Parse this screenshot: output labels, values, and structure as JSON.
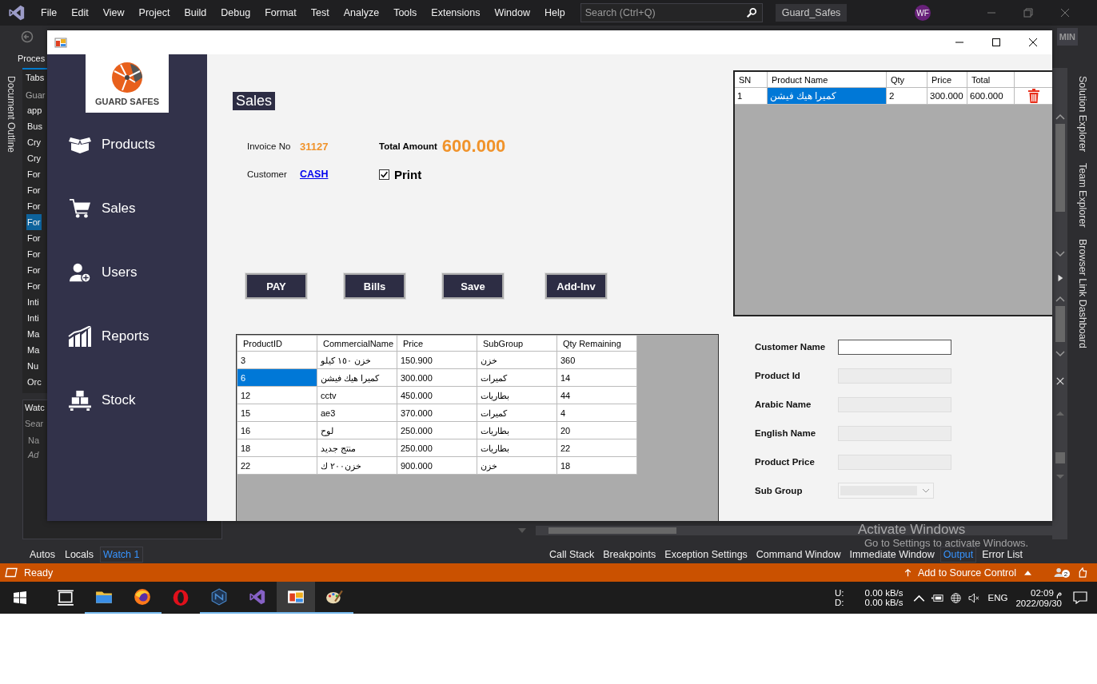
{
  "ide": {
    "menu": [
      "File",
      "Edit",
      "View",
      "Project",
      "Build",
      "Debug",
      "Format",
      "Test",
      "Analyze",
      "Tools",
      "Extensions",
      "Window",
      "Help"
    ],
    "search": {
      "placeholder": "Search (Ctrl+Q)"
    },
    "solution_name": "Guard_Safes",
    "user_initials": "WF",
    "toolbar_badge": "MIN",
    "process_label": "Proces",
    "left_strip": "Document Outline",
    "tabs_panel": {
      "title": "Tabs",
      "header": "Guar",
      "items": [
        {
          "text": "app",
          "selected": false
        },
        {
          "text": "Bus",
          "selected": false
        },
        {
          "text": "Cry",
          "selected": false
        },
        {
          "text": "Cry",
          "selected": false
        },
        {
          "text": "For",
          "selected": false
        },
        {
          "text": "For",
          "selected": false
        },
        {
          "text": "For",
          "selected": false
        },
        {
          "text": "For",
          "selected": true
        },
        {
          "text": "For",
          "selected": false
        },
        {
          "text": "For",
          "selected": false
        },
        {
          "text": "For",
          "selected": false
        },
        {
          "text": "For",
          "selected": false
        },
        {
          "text": "Inti",
          "selected": false
        },
        {
          "text": "Inti",
          "selected": false
        },
        {
          "text": "Ma",
          "selected": false
        },
        {
          "text": "Ma",
          "selected": false
        },
        {
          "text": "Nu",
          "selected": false
        },
        {
          "text": "Orc",
          "selected": false
        }
      ]
    },
    "watch_panel": {
      "title": "Watc",
      "search": "Sear",
      "column": "Na",
      "row": "Ad"
    },
    "bottom_left_tabs": [
      {
        "label": "Autos",
        "selected": false
      },
      {
        "label": "Locals",
        "selected": false
      },
      {
        "label": "Watch 1",
        "selected": true
      }
    ],
    "bottom_right_tabs": [
      {
        "label": "Call Stack",
        "selected": false
      },
      {
        "label": "Breakpoints",
        "selected": false
      },
      {
        "label": "Exception Settings",
        "selected": false
      },
      {
        "label": "Command Window",
        "selected": false
      },
      {
        "label": "Immediate Window",
        "selected": false
      },
      {
        "label": "Output",
        "selected": true
      },
      {
        "label": "Error List",
        "selected": false
      }
    ],
    "right_tabs": [
      "Solution Explorer",
      "Team Explorer",
      "Browser Link Dashboard"
    ],
    "status_bar": {
      "text": "Ready",
      "source_control": "Add to Source Control",
      "notifications": "2"
    }
  },
  "activation_notice": {
    "title": "Activate Windows",
    "text": "Go to Settings to activate Windows."
  },
  "app": {
    "logo": "GUARD SAFES",
    "nav": [
      {
        "kind": "products",
        "label": "Products"
      },
      {
        "kind": "sales",
        "label": "Sales"
      },
      {
        "kind": "users",
        "label": "Users"
      },
      {
        "kind": "reports",
        "label": "Reports"
      },
      {
        "kind": "stock",
        "label": "Stock"
      }
    ],
    "title": "Sales",
    "invoice": {
      "label": "Invoice No",
      "value": "31127"
    },
    "total": {
      "label": "Total Amount",
      "value": "600.000"
    },
    "customer": {
      "label": "Customer",
      "value": "CASH"
    },
    "print": {
      "label": "Print",
      "checked": true
    },
    "buttons": [
      "PAY",
      "Bills",
      "Save",
      "Add-Inv"
    ],
    "cart": {
      "columns": [
        "SN",
        "Product Name",
        "Qty",
        "Price",
        "Total"
      ],
      "rows": [
        {
          "cells": [
            {
              "text": "1",
              "selected": false
            },
            {
              "text": "كميرا هيك فيشن",
              "selected": true
            },
            {
              "text": "2",
              "selected": false
            },
            {
              "text": "300.000",
              "selected": false
            },
            {
              "text": "600.000",
              "selected": false
            }
          ]
        }
      ]
    },
    "products": {
      "columns": [
        "ProductID",
        "CommercialName",
        "Price",
        "SubGroup",
        "Qty Remaining"
      ],
      "rows": [
        {
          "cells": [
            {
              "text": "3",
              "selected": false
            },
            {
              "text": "خزن ١٥٠ كيلو",
              "selected": false
            },
            {
              "text": "150.900",
              "selected": false
            },
            {
              "text": "خزن",
              "selected": false
            },
            {
              "text": "360",
              "selected": false
            }
          ]
        },
        {
          "cells": [
            {
              "text": "6",
              "selected": true
            },
            {
              "text": "كميرا هيك فيشن",
              "selected": false
            },
            {
              "text": "300.000",
              "selected": false
            },
            {
              "text": "كميرات",
              "selected": false
            },
            {
              "text": "14",
              "selected": false
            }
          ]
        },
        {
          "cells": [
            {
              "text": "12",
              "selected": false
            },
            {
              "text": "cctv",
              "selected": false
            },
            {
              "text": "450.000",
              "selected": false
            },
            {
              "text": "بطاريات",
              "selected": false
            },
            {
              "text": "44",
              "selected": false
            }
          ]
        },
        {
          "cells": [
            {
              "text": "15",
              "selected": false
            },
            {
              "text": "ae3",
              "selected": false
            },
            {
              "text": "370.000",
              "selected": false
            },
            {
              "text": "كميرات",
              "selected": false
            },
            {
              "text": "4",
              "selected": false
            }
          ]
        },
        {
          "cells": [
            {
              "text": "16",
              "selected": false
            },
            {
              "text": "لوح",
              "selected": false
            },
            {
              "text": "250.000",
              "selected": false
            },
            {
              "text": "بطاريات",
              "selected": false
            },
            {
              "text": "20",
              "selected": false
            }
          ]
        },
        {
          "cells": [
            {
              "text": "18",
              "selected": false
            },
            {
              "text": "منتج جديد",
              "selected": false
            },
            {
              "text": "250.000",
              "selected": false
            },
            {
              "text": "بطاريات",
              "selected": false
            },
            {
              "text": "22",
              "selected": false
            }
          ]
        },
        {
          "cells": [
            {
              "text": "22",
              "selected": false
            },
            {
              "text": "خزن٢٠٠ ك",
              "selected": false
            },
            {
              "text": "900.000",
              "selected": false
            },
            {
              "text": "خزن",
              "selected": false
            },
            {
              "text": "18",
              "selected": false
            }
          ]
        }
      ]
    },
    "fields": [
      {
        "label": "Customer Name",
        "kind": "text",
        "disabled": false
      },
      {
        "label": "Product Id",
        "kind": "text",
        "disabled": true
      },
      {
        "label": "Arabic Name",
        "kind": "text",
        "disabled": true
      },
      {
        "label": "English Name",
        "kind": "text",
        "disabled": true
      },
      {
        "label": "Product Price",
        "kind": "text",
        "disabled": true
      },
      {
        "label": "Sub Group",
        "kind": "select",
        "disabled": true
      }
    ]
  },
  "taskbar": {
    "apps": [
      {
        "kind": "task-view",
        "selected": false,
        "running": false
      },
      {
        "kind": "folder",
        "selected": false,
        "running": true
      },
      {
        "kind": "firefox",
        "selected": false,
        "running": true
      },
      {
        "kind": "opera",
        "selected": false,
        "running": false
      },
      {
        "kind": "nox",
        "selected": false,
        "running": true
      },
      {
        "kind": "studio",
        "selected": false,
        "running": true
      },
      {
        "kind": "app",
        "selected": true,
        "running": true
      },
      {
        "kind": "paint",
        "selected": false,
        "running": true
      }
    ],
    "network": {
      "up_label": "U:",
      "down_label": "D:",
      "up": "0.00 kB/s",
      "down": "0.00 kB/s"
    },
    "language": "ENG",
    "time": "م 02:09",
    "date": "2022/09/30"
  }
}
